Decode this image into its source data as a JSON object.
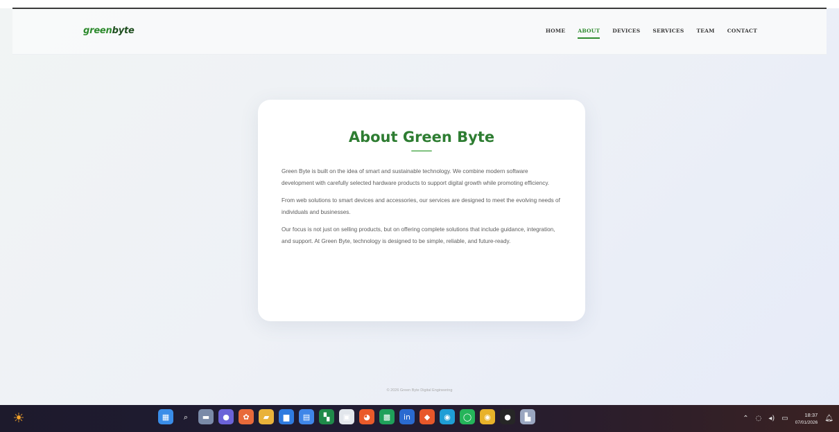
{
  "brand": {
    "prefix": "green",
    "suffix": "byte"
  },
  "nav": {
    "items": [
      {
        "label": "HOME",
        "active": false
      },
      {
        "label": "ABOUT",
        "active": true
      },
      {
        "label": "DEVICES",
        "active": false
      },
      {
        "label": "SERVICES",
        "active": false
      },
      {
        "label": "TEAM",
        "active": false
      },
      {
        "label": "CONTACT",
        "active": false
      }
    ]
  },
  "about": {
    "title": "About Green Byte",
    "paragraphs": [
      "Green Byte is built on the idea of smart and sustainable technology. We combine modern software development with carefully selected hardware products to support digital growth while promoting efficiency.",
      "From web solutions to smart devices and accessories, our services are designed to meet the evolving needs of individuals and businesses.",
      "Our focus is not just on selling products, but on offering complete solutions that include guidance, integration, and support. At Green Byte, technology is designed to be simple, reliable, and future-ready."
    ]
  },
  "footer": {
    "text": "© 2026 Green Byte Digital Engineering"
  },
  "taskbar": {
    "clock_time": "18:37",
    "clock_date": "07/01/2026",
    "apps": [
      {
        "icon": "windows-start-icon",
        "glyph": "▦",
        "color": "#3a8de8"
      },
      {
        "icon": "search-icon",
        "glyph": "⌕",
        "color": "transparent"
      },
      {
        "icon": "task-view-icon",
        "glyph": "▬",
        "color": "#7a8aa8"
      },
      {
        "icon": "meet-icon",
        "glyph": "●",
        "color": "#6b63d8"
      },
      {
        "icon": "widgets-icon",
        "glyph": "✿",
        "color": "#e86a3a"
      },
      {
        "icon": "file-explorer-icon",
        "glyph": "▰",
        "color": "#e9b23a"
      },
      {
        "icon": "store-icon",
        "glyph": "▆",
        "color": "#2f7be0"
      },
      {
        "icon": "notes-icon",
        "glyph": "▤",
        "color": "#3f86e8"
      },
      {
        "icon": "excel-icon",
        "glyph": "▚",
        "color": "#1f8a4a"
      },
      {
        "icon": "calendar-icon",
        "glyph": "▣",
        "color": "#e2e6ec"
      },
      {
        "icon": "paint-icon",
        "glyph": "◕",
        "color": "#ea5a2a"
      },
      {
        "icon": "media-icon",
        "glyph": "▩",
        "color": "#1fa05a"
      },
      {
        "icon": "linkedin-icon",
        "glyph": "in",
        "color": "#2a6ad0"
      },
      {
        "icon": "fire-icon",
        "glyph": "◆",
        "color": "#e8572a"
      },
      {
        "icon": "edge-icon",
        "glyph": "◉",
        "color": "#1f9ed6"
      },
      {
        "icon": "whatsapp-icon",
        "glyph": "◯",
        "color": "#25b45a"
      },
      {
        "icon": "chrome-icon",
        "glyph": "◉",
        "color": "#e8b22a"
      },
      {
        "icon": "circle-app-icon",
        "glyph": "●",
        "color": "#262626"
      },
      {
        "icon": "snipping-icon",
        "glyph": "▙",
        "color": "#9aa6c0"
      }
    ]
  }
}
